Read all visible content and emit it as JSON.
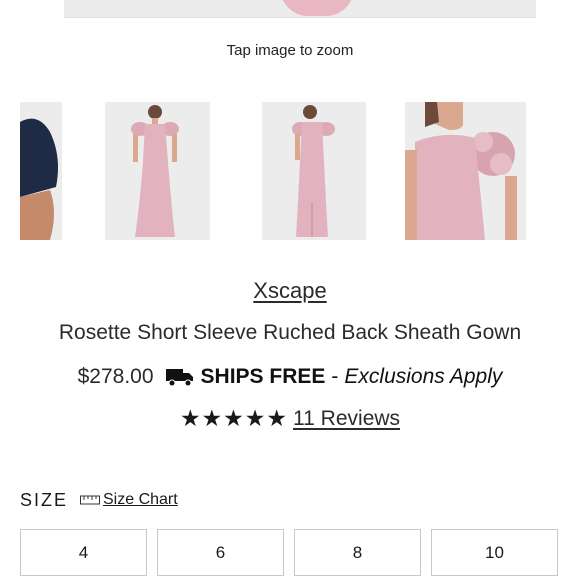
{
  "zoom_hint": "Tap image to zoom",
  "thumbnails": [
    {
      "icon": "navy-dress-partial-thumbnail"
    },
    {
      "icon": "pink-gown-front-thumbnail"
    },
    {
      "icon": "pink-gown-back-thumbnail"
    },
    {
      "icon": "pink-gown-closeup-thumbnail"
    }
  ],
  "product": {
    "brand": "Xscape",
    "name": "Rosette Short Sleeve Ruched Back Sheath Gown",
    "price": "$278.00",
    "ships_free": "SHIPS FREE",
    "ships_sep": "-",
    "exclusions": "Exclusions Apply",
    "stars": "★★★★★",
    "reviews": "11 Reviews"
  },
  "size": {
    "label": "SIZE",
    "chart_link": "Size Chart",
    "options": [
      "4",
      "6",
      "8",
      "10"
    ]
  },
  "colors": {
    "dress_pink": "#e2b3be",
    "navy": "#1f2a44",
    "thumb_bg": "#ebebeb"
  }
}
